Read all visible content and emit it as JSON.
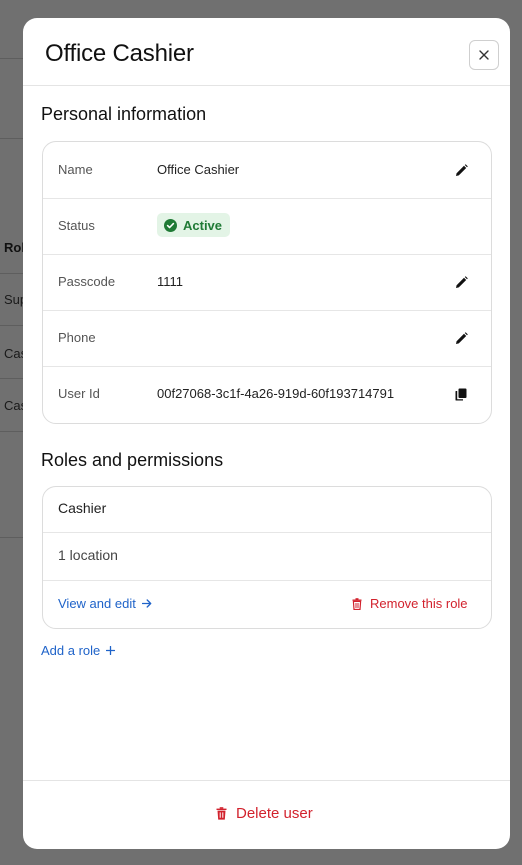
{
  "background": {
    "role_header": "Rol",
    "rows": [
      "Sup",
      "Cas",
      "Cas"
    ]
  },
  "modal": {
    "title": "Office Cashier",
    "close_icon": "close-icon"
  },
  "personal": {
    "section_title": "Personal information",
    "rows": [
      {
        "label": "Name",
        "value": "Office Cashier",
        "action_icon": "pencil-icon"
      },
      {
        "label": "Status",
        "value": "Active",
        "status_icon": "check-circle-icon"
      },
      {
        "label": "Passcode",
        "value": "1111",
        "action_icon": "pencil-icon"
      },
      {
        "label": "Phone",
        "value": "",
        "action_icon": "pencil-icon"
      },
      {
        "label": "User Id",
        "value": "00f27068-3c1f-4a26-919d-60f193714791",
        "action_icon": "copy-icon"
      }
    ]
  },
  "roles": {
    "section_title": "Roles and permissions",
    "role_name": "Cashier",
    "locations": "1 location",
    "view_edit_label": "View and edit",
    "remove_label": "Remove this role",
    "add_role_label": "Add a role"
  },
  "footer": {
    "delete_label": "Delete user"
  },
  "colors": {
    "accent_blue": "#1f63c9",
    "danger_red": "#d2222d",
    "status_green": "#1f7a35",
    "status_bg": "#e3f4e6",
    "overlay": "#707070"
  }
}
